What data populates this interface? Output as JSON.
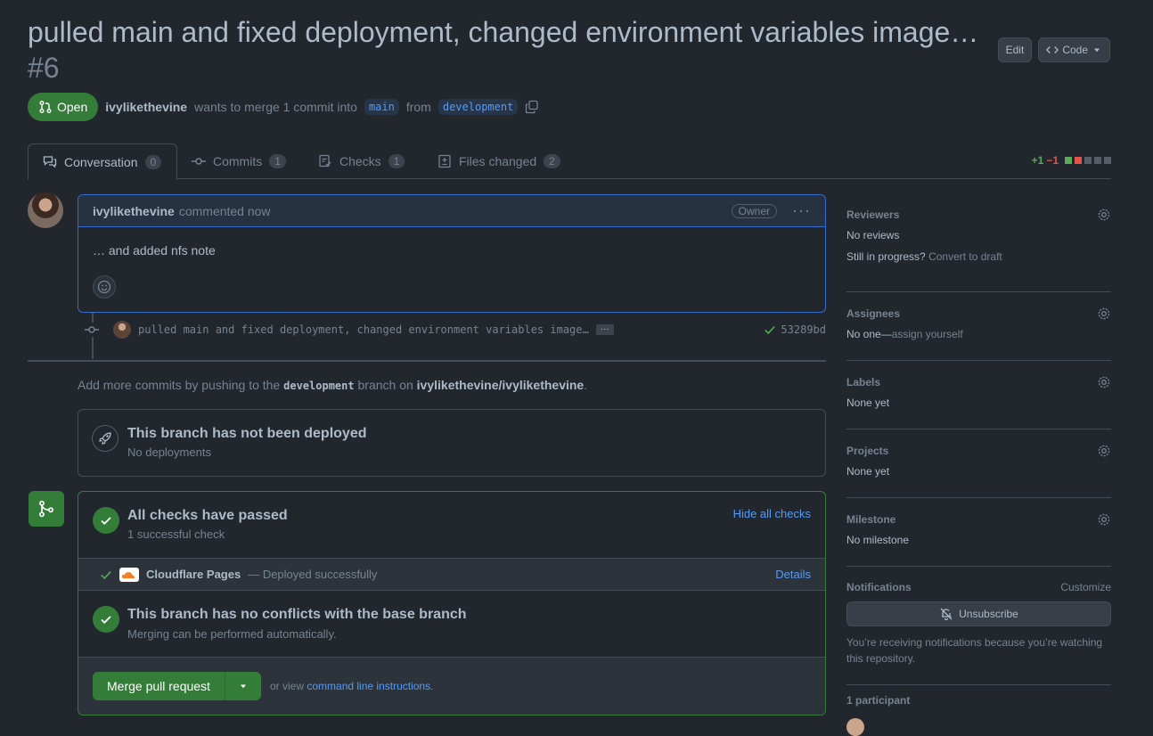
{
  "pr": {
    "title": "pulled main and fixed deployment, changed environment variables image…",
    "number": "#6",
    "edit_label": "Edit",
    "code_label": "Code",
    "state": "Open",
    "author": "ivylikethevine",
    "merge_text": "wants to merge 1 commit into",
    "base_branch": "main",
    "from_text": "from",
    "head_branch": "development"
  },
  "tabs": [
    {
      "label": "Conversation",
      "count": "0"
    },
    {
      "label": "Commits",
      "count": "1"
    },
    {
      "label": "Checks",
      "count": "1"
    },
    {
      "label": "Files changed",
      "count": "2"
    }
  ],
  "diffstat": {
    "add": "+1",
    "del": "−1"
  },
  "comment": {
    "author": "ivylikethevine",
    "action": "commented now",
    "badge": "Owner",
    "body": "… and added nfs note"
  },
  "commit": {
    "message": "pulled main and fixed deployment, changed environment variables image…",
    "sha": "53289bd"
  },
  "push_note": {
    "prefix": "Add more commits by pushing to the",
    "branch": "development",
    "middle": "branch on",
    "repo": "ivylikethevine/ivylikethevine",
    "suffix": "."
  },
  "deploy": {
    "title": "This branch has not been deployed",
    "sub": "No deployments"
  },
  "checks": {
    "title": "All checks have passed",
    "sub": "1 successful check",
    "hide_link": "Hide all checks",
    "item_name": "Cloudflare Pages",
    "item_status": "— Deployed successfully",
    "details_link": "Details"
  },
  "conflicts": {
    "title": "This branch has no conflicts with the base branch",
    "sub": "Merging can be performed automatically."
  },
  "merge": {
    "button": "Merge pull request",
    "or_view": "or view",
    "cli_link": "command line instructions",
    "cli_suffix": "."
  },
  "sidebar": {
    "reviewers": {
      "title": "Reviewers",
      "value": "No reviews",
      "progress": "Still in progress?",
      "draft_link": "Convert to draft"
    },
    "assignees": {
      "title": "Assignees",
      "value": "No one—",
      "assign_link": "assign yourself"
    },
    "labels": {
      "title": "Labels",
      "value": "None yet"
    },
    "projects": {
      "title": "Projects",
      "value": "None yet"
    },
    "milestone": {
      "title": "Milestone",
      "value": "No milestone"
    },
    "notifications": {
      "title": "Notifications",
      "customize": "Customize",
      "button": "Unsubscribe",
      "text": "You’re receiving notifications because you’re watching this repository."
    },
    "participants": {
      "title": "1 participant"
    }
  },
  "colors": {
    "accent": "#539bf5",
    "success": "#347d39",
    "background": "#22272e"
  }
}
